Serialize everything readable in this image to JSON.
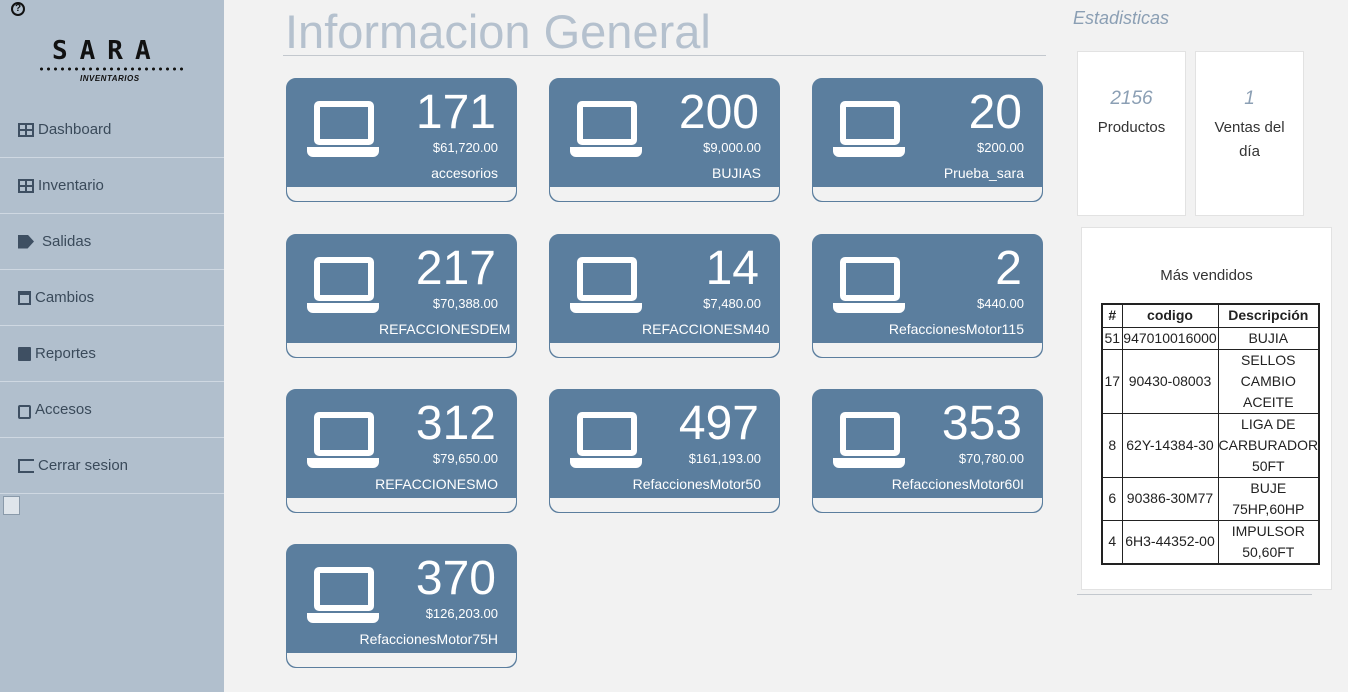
{
  "sidebar": {
    "help": "?",
    "logo": {
      "title": "SARA",
      "subtitle": "INVENTARIOS"
    },
    "items": [
      {
        "label": "Dashboard",
        "icon": "dashboard-icon"
      },
      {
        "label": "Inventario",
        "icon": "grid-icon"
      },
      {
        "label": "Salidas",
        "icon": "tags-icon"
      },
      {
        "label": "Cambios",
        "icon": "calendar-x-icon"
      },
      {
        "label": "Reportes",
        "icon": "book-icon"
      },
      {
        "label": "Accesos",
        "icon": "lock-icon"
      },
      {
        "label": "Cerrar sesion",
        "icon": "sign-out-icon"
      }
    ]
  },
  "main": {
    "title": "Informacion General",
    "cards": [
      {
        "count": "171",
        "amount": "$61,720.00",
        "label": "accesorios"
      },
      {
        "count": "200",
        "amount": "$9,000.00",
        "label": "BUJIAS"
      },
      {
        "count": "20",
        "amount": "$200.00",
        "label": "Prueba_sara"
      },
      {
        "count": "217",
        "amount": "$70,388.00",
        "label": "REFACCIONESDEM"
      },
      {
        "count": "14",
        "amount": "$7,480.00",
        "label": "REFACCIONESM40"
      },
      {
        "count": "2",
        "amount": "$440.00",
        "label": "RefaccionesMotor115"
      },
      {
        "count": "312",
        "amount": "$79,650.00",
        "label": "REFACCIONESMO"
      },
      {
        "count": "497",
        "amount": "$161,193.00",
        "label": "RefaccionesMotor50"
      },
      {
        "count": "353",
        "amount": "$70,780.00",
        "label": "RefaccionesMotor60I"
      },
      {
        "count": "370",
        "amount": "$126,203.00",
        "label": "RefaccionesMotor75H"
      }
    ]
  },
  "stats": {
    "title": "Estadisticas",
    "productos": {
      "value": "2156",
      "label": "Productos"
    },
    "ventas": {
      "value": "1",
      "label_line1": "Ventas del",
      "label_line2": "día"
    },
    "best": {
      "title": "Más vendidos",
      "headers": [
        "#",
        "codigo",
        "Descripción"
      ],
      "rows": [
        {
          "n": "51",
          "codigo": "947010016000",
          "desc": [
            "BUJIA"
          ]
        },
        {
          "n": "17",
          "codigo": "90430-08003",
          "desc": [
            "SELLOS",
            "CAMBIO",
            "ACEITE"
          ]
        },
        {
          "n": "8",
          "codigo": "62Y-14384-30",
          "desc": [
            "LIGA DE",
            "CARBURADOR",
            "50FT"
          ]
        },
        {
          "n": "6",
          "codigo": "90386-30M77",
          "desc": [
            "BUJE",
            "75HP,60HP"
          ]
        },
        {
          "n": "4",
          "codigo": "6H3-44352-00",
          "desc": [
            "IMPULSOR",
            "50,60FT"
          ]
        }
      ]
    }
  }
}
